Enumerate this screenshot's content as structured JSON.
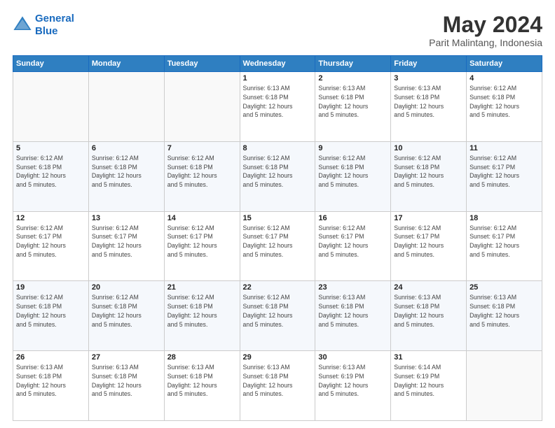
{
  "header": {
    "logo_line1": "General",
    "logo_line2": "Blue",
    "title": "May 2024",
    "subtitle": "Parit Malintang, Indonesia"
  },
  "weekdays": [
    "Sunday",
    "Monday",
    "Tuesday",
    "Wednesday",
    "Thursday",
    "Friday",
    "Saturday"
  ],
  "weeks": [
    [
      {
        "day": "",
        "info": ""
      },
      {
        "day": "",
        "info": ""
      },
      {
        "day": "",
        "info": ""
      },
      {
        "day": "1",
        "info": "Sunrise: 6:13 AM\nSunset: 6:18 PM\nDaylight: 12 hours\nand 5 minutes."
      },
      {
        "day": "2",
        "info": "Sunrise: 6:13 AM\nSunset: 6:18 PM\nDaylight: 12 hours\nand 5 minutes."
      },
      {
        "day": "3",
        "info": "Sunrise: 6:13 AM\nSunset: 6:18 PM\nDaylight: 12 hours\nand 5 minutes."
      },
      {
        "day": "4",
        "info": "Sunrise: 6:12 AM\nSunset: 6:18 PM\nDaylight: 12 hours\nand 5 minutes."
      }
    ],
    [
      {
        "day": "5",
        "info": "Sunrise: 6:12 AM\nSunset: 6:18 PM\nDaylight: 12 hours\nand 5 minutes."
      },
      {
        "day": "6",
        "info": "Sunrise: 6:12 AM\nSunset: 6:18 PM\nDaylight: 12 hours\nand 5 minutes."
      },
      {
        "day": "7",
        "info": "Sunrise: 6:12 AM\nSunset: 6:18 PM\nDaylight: 12 hours\nand 5 minutes."
      },
      {
        "day": "8",
        "info": "Sunrise: 6:12 AM\nSunset: 6:18 PM\nDaylight: 12 hours\nand 5 minutes."
      },
      {
        "day": "9",
        "info": "Sunrise: 6:12 AM\nSunset: 6:18 PM\nDaylight: 12 hours\nand 5 minutes."
      },
      {
        "day": "10",
        "info": "Sunrise: 6:12 AM\nSunset: 6:18 PM\nDaylight: 12 hours\nand 5 minutes."
      },
      {
        "day": "11",
        "info": "Sunrise: 6:12 AM\nSunset: 6:17 PM\nDaylight: 12 hours\nand 5 minutes."
      }
    ],
    [
      {
        "day": "12",
        "info": "Sunrise: 6:12 AM\nSunset: 6:17 PM\nDaylight: 12 hours\nand 5 minutes."
      },
      {
        "day": "13",
        "info": "Sunrise: 6:12 AM\nSunset: 6:17 PM\nDaylight: 12 hours\nand 5 minutes."
      },
      {
        "day": "14",
        "info": "Sunrise: 6:12 AM\nSunset: 6:17 PM\nDaylight: 12 hours\nand 5 minutes."
      },
      {
        "day": "15",
        "info": "Sunrise: 6:12 AM\nSunset: 6:17 PM\nDaylight: 12 hours\nand 5 minutes."
      },
      {
        "day": "16",
        "info": "Sunrise: 6:12 AM\nSunset: 6:17 PM\nDaylight: 12 hours\nand 5 minutes."
      },
      {
        "day": "17",
        "info": "Sunrise: 6:12 AM\nSunset: 6:17 PM\nDaylight: 12 hours\nand 5 minutes."
      },
      {
        "day": "18",
        "info": "Sunrise: 6:12 AM\nSunset: 6:17 PM\nDaylight: 12 hours\nand 5 minutes."
      }
    ],
    [
      {
        "day": "19",
        "info": "Sunrise: 6:12 AM\nSunset: 6:18 PM\nDaylight: 12 hours\nand 5 minutes."
      },
      {
        "day": "20",
        "info": "Sunrise: 6:12 AM\nSunset: 6:18 PM\nDaylight: 12 hours\nand 5 minutes."
      },
      {
        "day": "21",
        "info": "Sunrise: 6:12 AM\nSunset: 6:18 PM\nDaylight: 12 hours\nand 5 minutes."
      },
      {
        "day": "22",
        "info": "Sunrise: 6:12 AM\nSunset: 6:18 PM\nDaylight: 12 hours\nand 5 minutes."
      },
      {
        "day": "23",
        "info": "Sunrise: 6:13 AM\nSunset: 6:18 PM\nDaylight: 12 hours\nand 5 minutes."
      },
      {
        "day": "24",
        "info": "Sunrise: 6:13 AM\nSunset: 6:18 PM\nDaylight: 12 hours\nand 5 minutes."
      },
      {
        "day": "25",
        "info": "Sunrise: 6:13 AM\nSunset: 6:18 PM\nDaylight: 12 hours\nand 5 minutes."
      }
    ],
    [
      {
        "day": "26",
        "info": "Sunrise: 6:13 AM\nSunset: 6:18 PM\nDaylight: 12 hours\nand 5 minutes."
      },
      {
        "day": "27",
        "info": "Sunrise: 6:13 AM\nSunset: 6:18 PM\nDaylight: 12 hours\nand 5 minutes."
      },
      {
        "day": "28",
        "info": "Sunrise: 6:13 AM\nSunset: 6:18 PM\nDaylight: 12 hours\nand 5 minutes."
      },
      {
        "day": "29",
        "info": "Sunrise: 6:13 AM\nSunset: 6:18 PM\nDaylight: 12 hours\nand 5 minutes."
      },
      {
        "day": "30",
        "info": "Sunrise: 6:13 AM\nSunset: 6:19 PM\nDaylight: 12 hours\nand 5 minutes."
      },
      {
        "day": "31",
        "info": "Sunrise: 6:14 AM\nSunset: 6:19 PM\nDaylight: 12 hours\nand 5 minutes."
      },
      {
        "day": "",
        "info": ""
      }
    ]
  ]
}
